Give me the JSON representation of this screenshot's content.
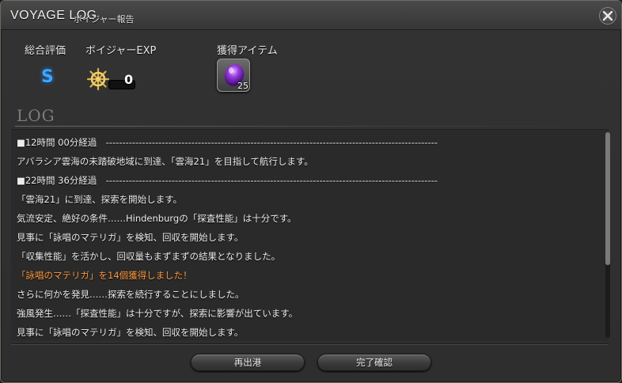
{
  "window": {
    "title": "VOYAGE LOG",
    "subtitle": "ボイジャー報告",
    "close_icon": "close-icon"
  },
  "summary": {
    "rating_label": "総合評価",
    "rating_value": "S",
    "exp_label": "ボイジャーEXP",
    "exp_value": "0",
    "exp_icon": "ship-wheel-icon",
    "items_label": "獲得アイテム",
    "item_icon": "purple-materia-icon",
    "item_count": "25"
  },
  "log": {
    "heading": "LOG",
    "lines": [
      {
        "text": "■12時間 00分経過　-----------------------------------------------------------------------------------------------------",
        "highlight": false
      },
      {
        "text": "アバラシア雲海の未踏破地域に到達、「雲海21」を目指して航行します。",
        "highlight": false
      },
      {
        "text": "■22時間 36分経過　-----------------------------------------------------------------------------------------------------",
        "highlight": false
      },
      {
        "text": "「雲海21」に到達、探索を開始します。",
        "highlight": false
      },
      {
        "text": "気流安定、絶好の条件……Hindenburgの「探査性能」は十分です。",
        "highlight": false
      },
      {
        "text": "見事に「詠唱のマテリガ」を検知、回収を開始します。",
        "highlight": false
      },
      {
        "text": "「収集性能」を活かし、回収量もまずまずの結果となりました。",
        "highlight": false
      },
      {
        "text": "「詠唱のマテリガ」を14個獲得しました！",
        "highlight": true
      },
      {
        "text": "さらに何かを発見……探索を続行することにしました。",
        "highlight": false
      },
      {
        "text": "強風発生……「探査性能」は十分ですが、探索に影響が出ています。",
        "highlight": false
      },
      {
        "text": "見事に「詠唱のマテリガ」を検知、回収を開始します。",
        "highlight": false
      }
    ]
  },
  "buttons": {
    "redeploy": "再出港",
    "confirm": "完了確認"
  },
  "colors": {
    "highlight": "#ff9a40",
    "grade": "#3fa6ff"
  }
}
